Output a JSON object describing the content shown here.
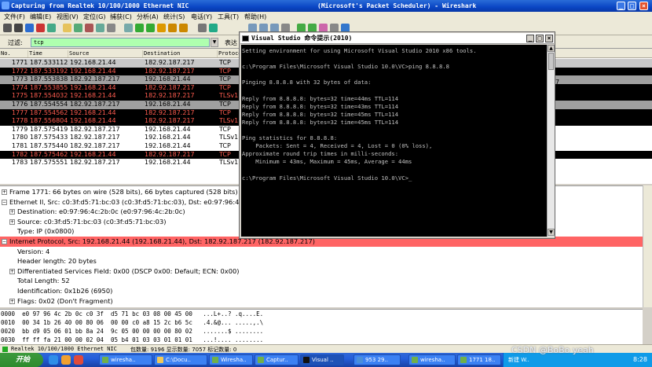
{
  "window": {
    "title_left": "Capturing from Realtek 10/100/1000 Ethernet NIC",
    "title_right": "(Microsoft's Packet Scheduler)  - Wireshark"
  },
  "menu": [
    "文件(F)",
    "编辑(E)",
    "视图(V)",
    "定位(G)",
    "捕获(C)",
    "分析(A)",
    "统计(S)",
    "电话(Y)",
    "工具(T)",
    "帮助(H)"
  ],
  "filter": {
    "label": "过滤:",
    "value": "tcp",
    "expr_label": "表达"
  },
  "packet_columns": [
    "No.",
    "Time",
    "Source",
    "Destination",
    "Protoco"
  ],
  "packets": [
    {
      "no": "1771",
      "time": "187.533112",
      "src": "192.168.21.44",
      "dst": "182.92.187.217",
      "proto": "TCP",
      "style": "r-tcp"
    },
    {
      "no": "1772",
      "time": "187.533192",
      "src": "192.168.21.44",
      "dst": "182.92.187.217",
      "proto": "TCP",
      "style": "r-bad"
    },
    {
      "no": "1773",
      "time": "187.553838",
      "src": "182.92.187.217",
      "dst": "192.168.21.44",
      "proto": "TCP",
      "style": "r-tls"
    },
    {
      "no": "1774",
      "time": "187.553855",
      "src": "192.168.21.44",
      "dst": "182.92.187.217",
      "proto": "TCP",
      "style": "r-bad"
    },
    {
      "no": "1775",
      "time": "187.554032",
      "src": "192.168.21.44",
      "dst": "182.92.187.217",
      "proto": "TLSv1",
      "style": "r-bad"
    },
    {
      "no": "1776",
      "time": "187.554554",
      "src": "182.92.187.217",
      "dst": "192.168.21.44",
      "proto": "TCP",
      "style": "r-tls"
    },
    {
      "no": "1777",
      "time": "187.554562",
      "src": "192.168.21.44",
      "dst": "182.92.187.217",
      "proto": "TCP",
      "style": "r-bad"
    },
    {
      "no": "1778",
      "time": "187.556804",
      "src": "192.168.21.44",
      "dst": "182.92.187.217",
      "proto": "TLSv1",
      "style": "r-bad"
    },
    {
      "no": "1779",
      "time": "187.575419",
      "src": "182.92.187.217",
      "dst": "192.168.21.44",
      "proto": "TCP",
      "style": "r-white"
    },
    {
      "no": "1780",
      "time": "187.575433",
      "src": "182.92.187.217",
      "dst": "192.168.21.44",
      "proto": "TLSv1",
      "style": "r-white"
    },
    {
      "no": "1781",
      "time": "187.575440",
      "src": "182.92.187.217",
      "dst": "192.168.21.44",
      "proto": "TCP",
      "style": "r-white"
    },
    {
      "no": "1782",
      "time": "187.575462",
      "src": "192.168.21.44",
      "dst": "182.92.187.217",
      "proto": "TCP",
      "style": "r-bad"
    },
    {
      "no": "1783",
      "time": "187.575551",
      "src": "182.92.187.217",
      "dst": "192.168.21.44",
      "proto": "TLSv1",
      "style": "r-white"
    }
  ],
  "details": [
    {
      "text": "Frame 1771: 66 bytes on wire (528 bits), 66 bytes captured (528 bits)",
      "indent": 0,
      "exp": "+"
    },
    {
      "text": "Ethernet II, Src: c0:3f:d5:71:bc:03 (c0:3f:d5:71:bc:03), Dst: e0:97:96:4c",
      "indent": 0,
      "exp": "-"
    },
    {
      "text": "Destination: e0:97:96:4c:2b:0c (e0:97:96:4c:2b:0c)",
      "indent": 1,
      "exp": "+"
    },
    {
      "text": "Source: c0:3f:d5:71:bc:03 (c0:3f:d5:71:bc:03)",
      "indent": 1,
      "exp": "+"
    },
    {
      "text": "Type: IP (0x0800)",
      "indent": 1,
      "exp": ""
    },
    {
      "text": "Internet Protocol, Src: 192.168.21.44 (192.168.21.44), Dst: 182.92.187.217 (182.92.187.217)",
      "indent": 0,
      "exp": "-",
      "highlight": true
    },
    {
      "text": "Version: 4",
      "indent": 1,
      "exp": ""
    },
    {
      "text": "Header length: 20 bytes",
      "indent": 1,
      "exp": ""
    },
    {
      "text": "Differentiated Services Field: 0x00 (DSCP 0x00: Default; ECN: 0x00)",
      "indent": 1,
      "exp": "+"
    },
    {
      "text": "Total Length: 52",
      "indent": 1,
      "exp": ""
    },
    {
      "text": "Identification: 0x1b26 (6950)",
      "indent": 1,
      "exp": ""
    },
    {
      "text": "Flags: 0x02 (Don't Fragment)",
      "indent": 1,
      "exp": "+"
    }
  ],
  "hex": [
    "0000  e0 97 96 4c 2b 0c c0 3f  d5 71 bc 03 08 00 45 00   ...L+..? .q....E.",
    "0010  00 34 1b 26 40 00 80 06  00 00 c0 a8 15 2c b6 5c   .4.&@... .....,.\\",
    "0020  bb d9 05 06 01 bb 8a 24  9c 05 00 00 00 00 80 02   .......$ ........",
    "0030  ff ff fa 21 00 00 02 04  05 b4 01 03 03 01 01 01   ...!.... ........"
  ],
  "status": {
    "nic": "Realtek 10/100/1000 Ethernet NIC",
    "packets": "包数量: 9196 显示数量: 7057 标记数量: 0"
  },
  "cmd": {
    "title": "Visual Studio 命令提示(2010)",
    "lines": [
      "Setting environment for using Microsoft Visual Studio 2010 x86 tools.",
      "",
      "c:\\Program Files\\Microsoft Visual Studio 10.0\\VC>ping 8.8.8.8",
      "",
      "Pinging 8.8.8.8 with 32 bytes of data:",
      "",
      "Reply from 8.8.8.8: bytes=32 time=44ms TTL=114",
      "Reply from 8.8.8.8: bytes=32 time=43ms TTL=114",
      "Reply from 8.8.8.8: bytes=32 time=45ms TTL=114",
      "Reply from 8.8.8.8: bytes=32 time=45ms TTL=114",
      "",
      "Ping statistics for 8.8.8.8:",
      "    Packets: Sent = 4, Received = 4, Lost = 0 (0% loss),",
      "Approximate round trip times in milli-seconds:",
      "    Minimum = 43ms, Maximum = 45ms, Average = 44ms",
      "",
      "c:\\Program Files\\Microsoft Visual Studio 10.0\\VC>_"
    ]
  },
  "taskbar": {
    "start": "开始",
    "tasks": [
      "wiresha..",
      "C:\\Docu..",
      "Wiresha..",
      "Captur..",
      "Visual ..",
      "953 29..",
      "wiresha..",
      "1771 18.."
    ],
    "tray_text": "新建 W..",
    "clock": "8:28",
    "watermark": "CSDN @BoBo yeah"
  },
  "colors": {
    "title": "#0a46c4",
    "highlight_row": "#ff6060",
    "filter_bg": "#afffaf"
  }
}
